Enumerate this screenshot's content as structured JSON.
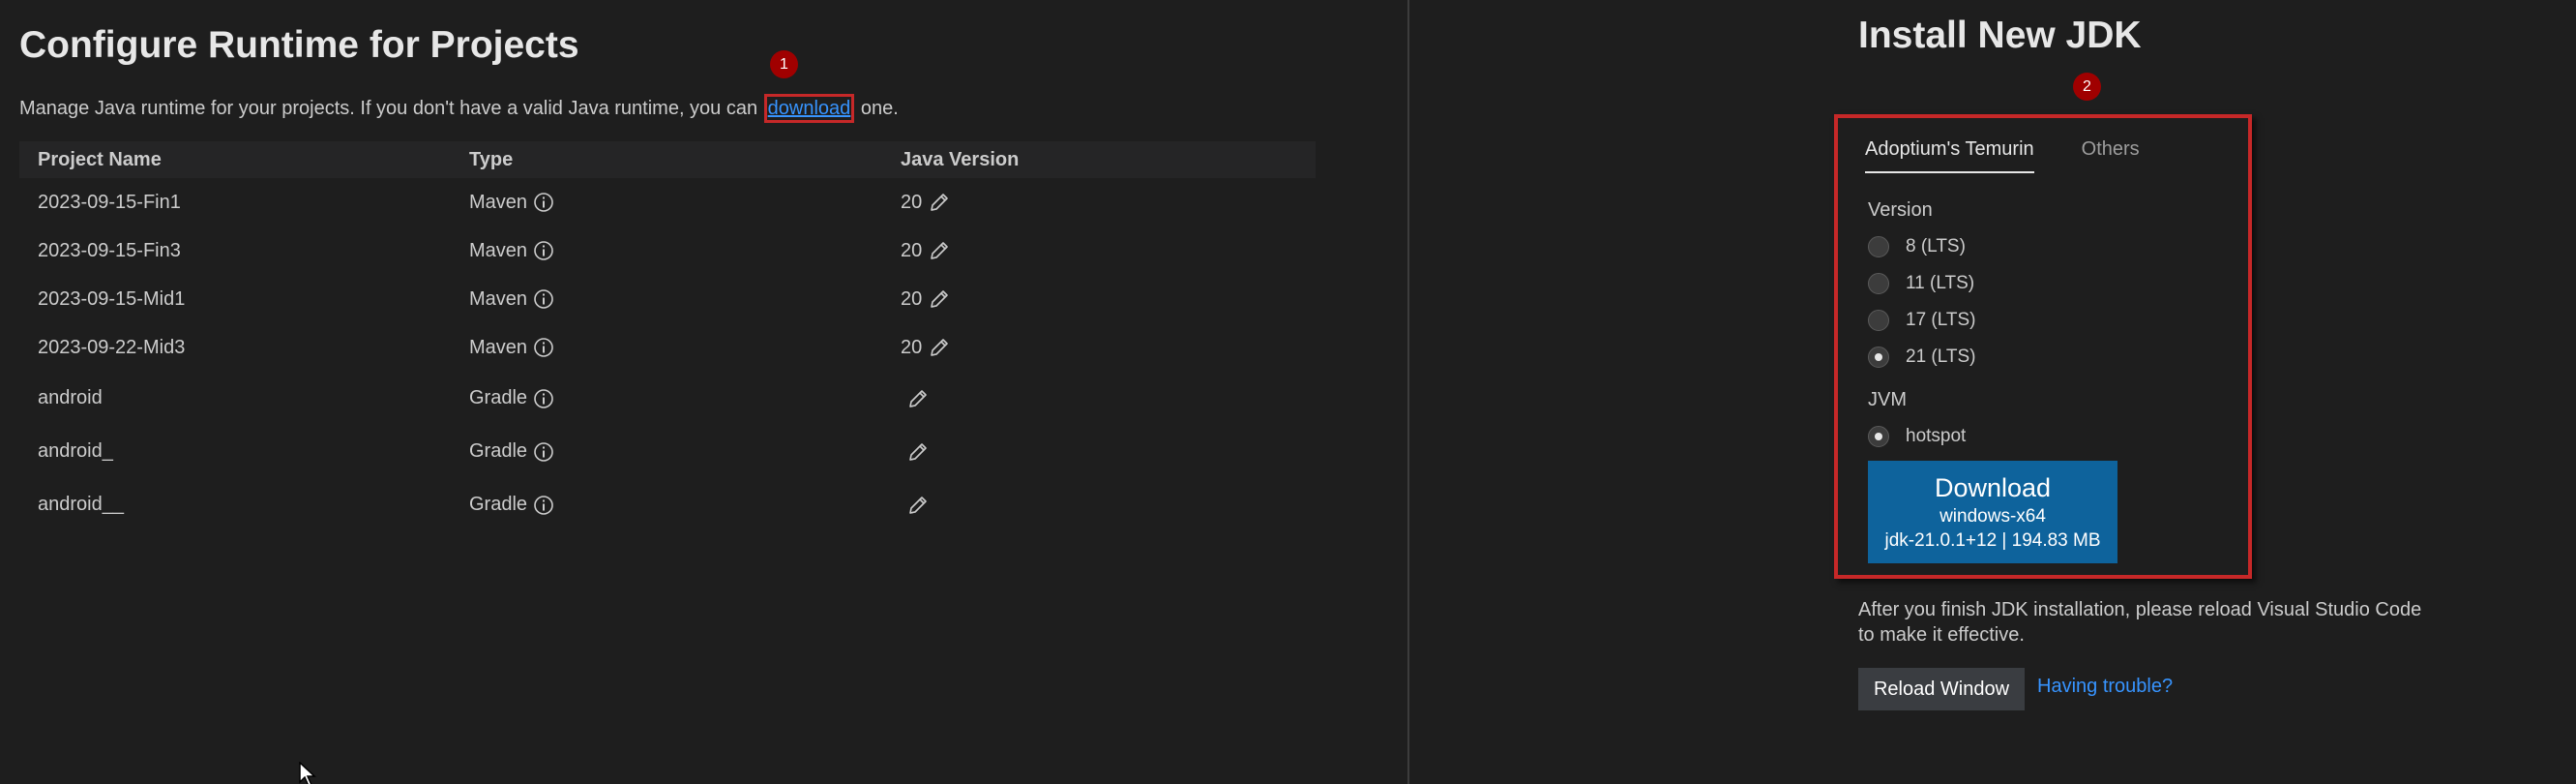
{
  "left": {
    "title": "Configure Runtime for Projects",
    "intro_before": "Manage Java runtime for your projects. If you don't have a valid Java runtime, you can ",
    "intro_link": "download",
    "intro_after": " one.",
    "badge": "1",
    "table": {
      "headers": {
        "name": "Project Name",
        "type": "Type",
        "java": "Java Version"
      },
      "rows": [
        {
          "name": "2023-09-15-Fin1",
          "type": "Maven",
          "java": "20"
        },
        {
          "name": "2023-09-15-Fin3",
          "type": "Maven",
          "java": "20"
        },
        {
          "name": "2023-09-15-Mid1",
          "type": "Maven",
          "java": "20"
        },
        {
          "name": "2023-09-22-Mid3",
          "type": "Maven",
          "java": "20"
        },
        {
          "name": "android",
          "type": "Gradle",
          "java": ""
        },
        {
          "name": "android_",
          "type": "Gradle",
          "java": ""
        },
        {
          "name": "android__",
          "type": "Gradle",
          "java": ""
        }
      ]
    }
  },
  "right": {
    "title": "Install New JDK",
    "badge": "2",
    "tabs": [
      {
        "label": "Adoptium's Temurin",
        "active": true
      },
      {
        "label": "Others",
        "active": false
      }
    ],
    "version_label": "Version",
    "versions": [
      {
        "label": "8 (LTS)",
        "checked": false
      },
      {
        "label": "11 (LTS)",
        "checked": false
      },
      {
        "label": "17 (LTS)",
        "checked": false
      },
      {
        "label": "21 (LTS)",
        "checked": true
      }
    ],
    "jvm_label": "JVM",
    "jvm_options": [
      {
        "label": "hotspot",
        "checked": true
      }
    ],
    "download": {
      "label": "Download",
      "platform": "windows-x64",
      "details": "jdk-21.0.1+12 | 194.83 MB"
    },
    "after_text": "After you finish JDK installation, please reload Visual Studio Code to make it effective.",
    "reload_label": "Reload Window",
    "trouble_label": "Having trouble?"
  },
  "colors": {
    "background": "#1e1e1e",
    "link": "#3794ff",
    "primary_button": "#0e639c",
    "secondary_button": "#3a3d41",
    "highlight_border": "#c62828",
    "badge": "#a00000"
  },
  "icons": {
    "info": "info-circle-icon",
    "edit": "pencil-icon",
    "cursor": "mouse-pointer-icon"
  }
}
